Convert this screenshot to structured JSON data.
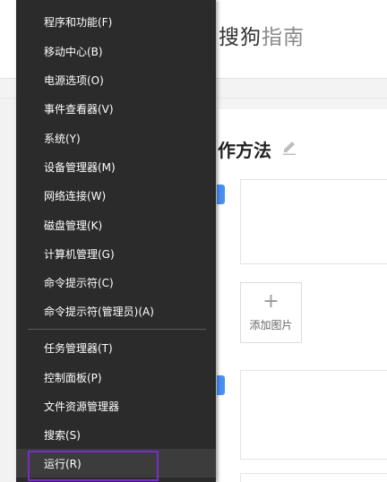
{
  "background": {
    "logo": {
      "brand": "搜狗",
      "sub": "指南"
    },
    "section_title": "作方法",
    "add_image": {
      "plus": "+",
      "label": "添加图片"
    }
  },
  "context_menu": {
    "groups": [
      {
        "items": [
          {
            "label": "程序和功能(F)"
          },
          {
            "label": "移动中心(B)"
          },
          {
            "label": "电源选项(O)"
          },
          {
            "label": "事件查看器(V)"
          },
          {
            "label": "系统(Y)"
          },
          {
            "label": "设备管理器(M)"
          },
          {
            "label": "网络连接(W)"
          },
          {
            "label": "磁盘管理(K)"
          },
          {
            "label": "计算机管理(G)"
          },
          {
            "label": "命令提示符(C)"
          },
          {
            "label": "命令提示符(管理员)(A)"
          }
        ]
      },
      {
        "items": [
          {
            "label": "任务管理器(T)"
          },
          {
            "label": "控制面板(P)"
          },
          {
            "label": "文件资源管理器"
          },
          {
            "label": "搜索(S)"
          },
          {
            "label": "运行(R)",
            "highlighted": true
          }
        ]
      }
    ],
    "highlight_color": "#7b2cc6"
  },
  "colors": {
    "menu_bg": "#2b2b2b",
    "accent_blue": "#4a8ef3"
  }
}
